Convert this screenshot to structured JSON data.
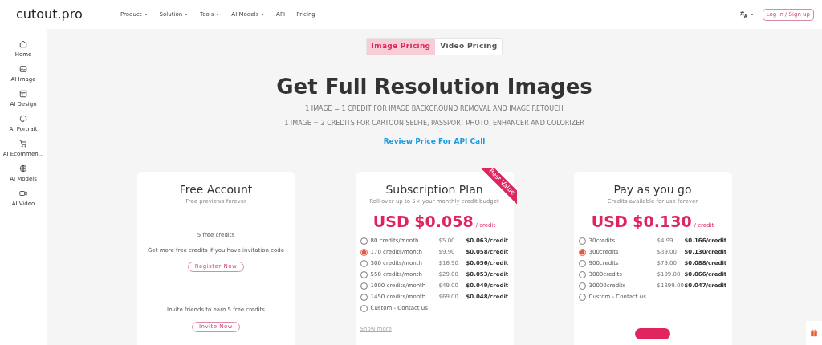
{
  "header": {
    "logo": "cutout.pro",
    "nav": [
      {
        "label": "Product",
        "dropdown": true
      },
      {
        "label": "Solution",
        "dropdown": true
      },
      {
        "label": "Tools",
        "dropdown": true
      },
      {
        "label": "AI Models",
        "dropdown": true
      },
      {
        "label": "API",
        "dropdown": false
      },
      {
        "label": "Pricing",
        "dropdown": false
      }
    ],
    "login": "Log in / Sign up"
  },
  "sidebar": {
    "items": [
      {
        "kind": "home",
        "label": "Home"
      },
      {
        "kind": "image",
        "label": "AI Image"
      },
      {
        "kind": "design",
        "label": "AI Design"
      },
      {
        "kind": "portrait",
        "label": "AI Portrait"
      },
      {
        "kind": "cart",
        "label": "AI Ecommen..."
      },
      {
        "kind": "models",
        "label": "AI Models"
      },
      {
        "kind": "video",
        "label": "AI Video"
      }
    ]
  },
  "tabs": [
    {
      "label": "Image Pricing",
      "selected": true
    },
    {
      "label": "Video Pricing",
      "selected": false
    }
  ],
  "title": "Get Full Resolution Images",
  "subtitles": [
    "1 IMAGE = 1 CREDIT FOR IMAGE BACKGROUND REMOVAL AND IMAGE RETOUCH",
    "1 IMAGE = 2 CREDITS FOR CARTOON SELFIE, PASSPORT PHOTO, ENHANCER AND COLORIZER"
  ],
  "api_link": "Review Price For API Call",
  "cards": [
    {
      "kind": "free",
      "title": "Free Account",
      "subtitle": "Free previews forever",
      "credits": "5 free credits",
      "note": "Get more free credits if you have invitation code",
      "register": "Register Now",
      "invite_note": "Invite friends to earn 5 free credits",
      "invite": "Invite Now"
    },
    {
      "kind": "plans",
      "title": "Subscription Plan",
      "subtitle": "Roll over up to 5× your monthly credit budget",
      "ribbon": "Best Value",
      "price": "USD $0.058",
      "unit": "/ credit",
      "options": [
        {
          "label": "80 credits/month",
          "price": "$5.00",
          "per_credit": "$0.063/credit",
          "selected": false
        },
        {
          "label": "170 credits/month",
          "price": "$9.90",
          "per_credit": "$0.058/credit",
          "selected": true
        },
        {
          "label": "300 credits/month",
          "price": "$16.90",
          "per_credit": "$0.056/credit",
          "selected": false
        },
        {
          "label": "550 credits/month",
          "price": "$29.00",
          "per_credit": "$0.053/credit",
          "selected": false
        },
        {
          "label": "1000 credits/month",
          "price": "$49.00",
          "per_credit": "$0.049/credit",
          "selected": false
        },
        {
          "label": "1450 credits/month",
          "price": "$69.00",
          "per_credit": "$0.048/credit",
          "selected": false
        },
        {
          "label": "Custom - Contact us",
          "selected": false
        }
      ],
      "more": "Show more"
    },
    {
      "kind": "plans",
      "title": "Pay as you go",
      "subtitle": "Credits available for use forever",
      "price": "USD $0.130",
      "unit": "/ credit",
      "options": [
        {
          "label": "30credits",
          "price": "$4.99",
          "per_credit": "$0.166/credit",
          "selected": false
        },
        {
          "label": "300credits",
          "price": "$39.00",
          "per_credit": "$0.130/credit",
          "selected": true
        },
        {
          "label": "900credits",
          "price": "$79.00",
          "per_credit": "$0.088/credit",
          "selected": false
        },
        {
          "label": "3000credits",
          "price": "$199.00",
          "per_credit": "$0.066/credit",
          "selected": false
        },
        {
          "label": "30000credits",
          "price": "$1399.00",
          "per_credit": "$0.047/credit",
          "selected": false
        },
        {
          "label": "Custom - Contact us",
          "selected": false
        }
      ],
      "buy_button": true
    }
  ]
}
